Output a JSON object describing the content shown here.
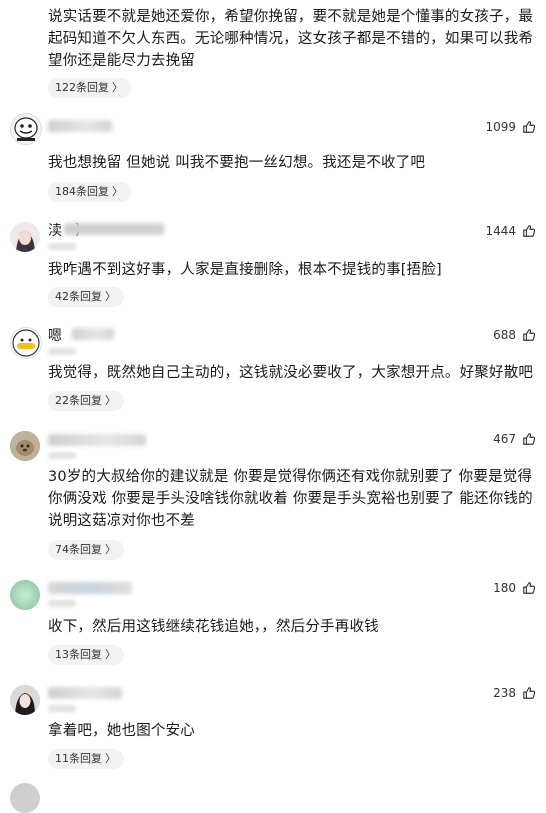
{
  "comments": [
    {
      "text": "说实话要不就是她还爱你，希望你挽留，要不就是她是个懂事的女孩子，最起码知道不欠人东西。无论哪种情况，这女孩子都是不错的，如果可以我希望你还是能尽力去挽留",
      "replies": "122条回复",
      "likes": ""
    },
    {
      "likes": "1099",
      "text": "我也想挽留 但她说 叫我不要抱一丝幻想。我还是不收了吧",
      "replies": "184条回复",
      "name_visible": ""
    },
    {
      "likes": "1444",
      "name_visible": "渎   ）",
      "text": "我咋遇不到这好事，人家是直接删除，根本不提钱的事[捂脸]",
      "replies": "42条回复"
    },
    {
      "likes": "688",
      "name_visible": "嗯",
      "text": "我觉得，既然她自己主动的，这钱就没必要收了，大家想开点。好聚好散吧",
      "replies": "22条回复"
    },
    {
      "likes": "467",
      "name_visible": "",
      "text": "30岁的大叔给你的建议就是 你要是觉得你俩还有戏你就别要了 你要是觉得你俩没戏 你要是手头没啥钱你就收着 你要是手头宽裕也别要了 能还你钱的说明这菇凉对你也不差",
      "replies": "74条回复"
    },
    {
      "likes": "180",
      "name_visible": "",
      "text": "收下，然后用这钱继续花钱追她，，然后分手再收钱",
      "replies": "13条回复"
    },
    {
      "likes": "238",
      "name_visible": "",
      "text": "拿着吧，她也图个安心",
      "replies": "11条回复"
    }
  ],
  "icons": {
    "like": "thumbs-up-icon",
    "chevron": "chevron-right-icon"
  },
  "reply_chevron": "〉"
}
